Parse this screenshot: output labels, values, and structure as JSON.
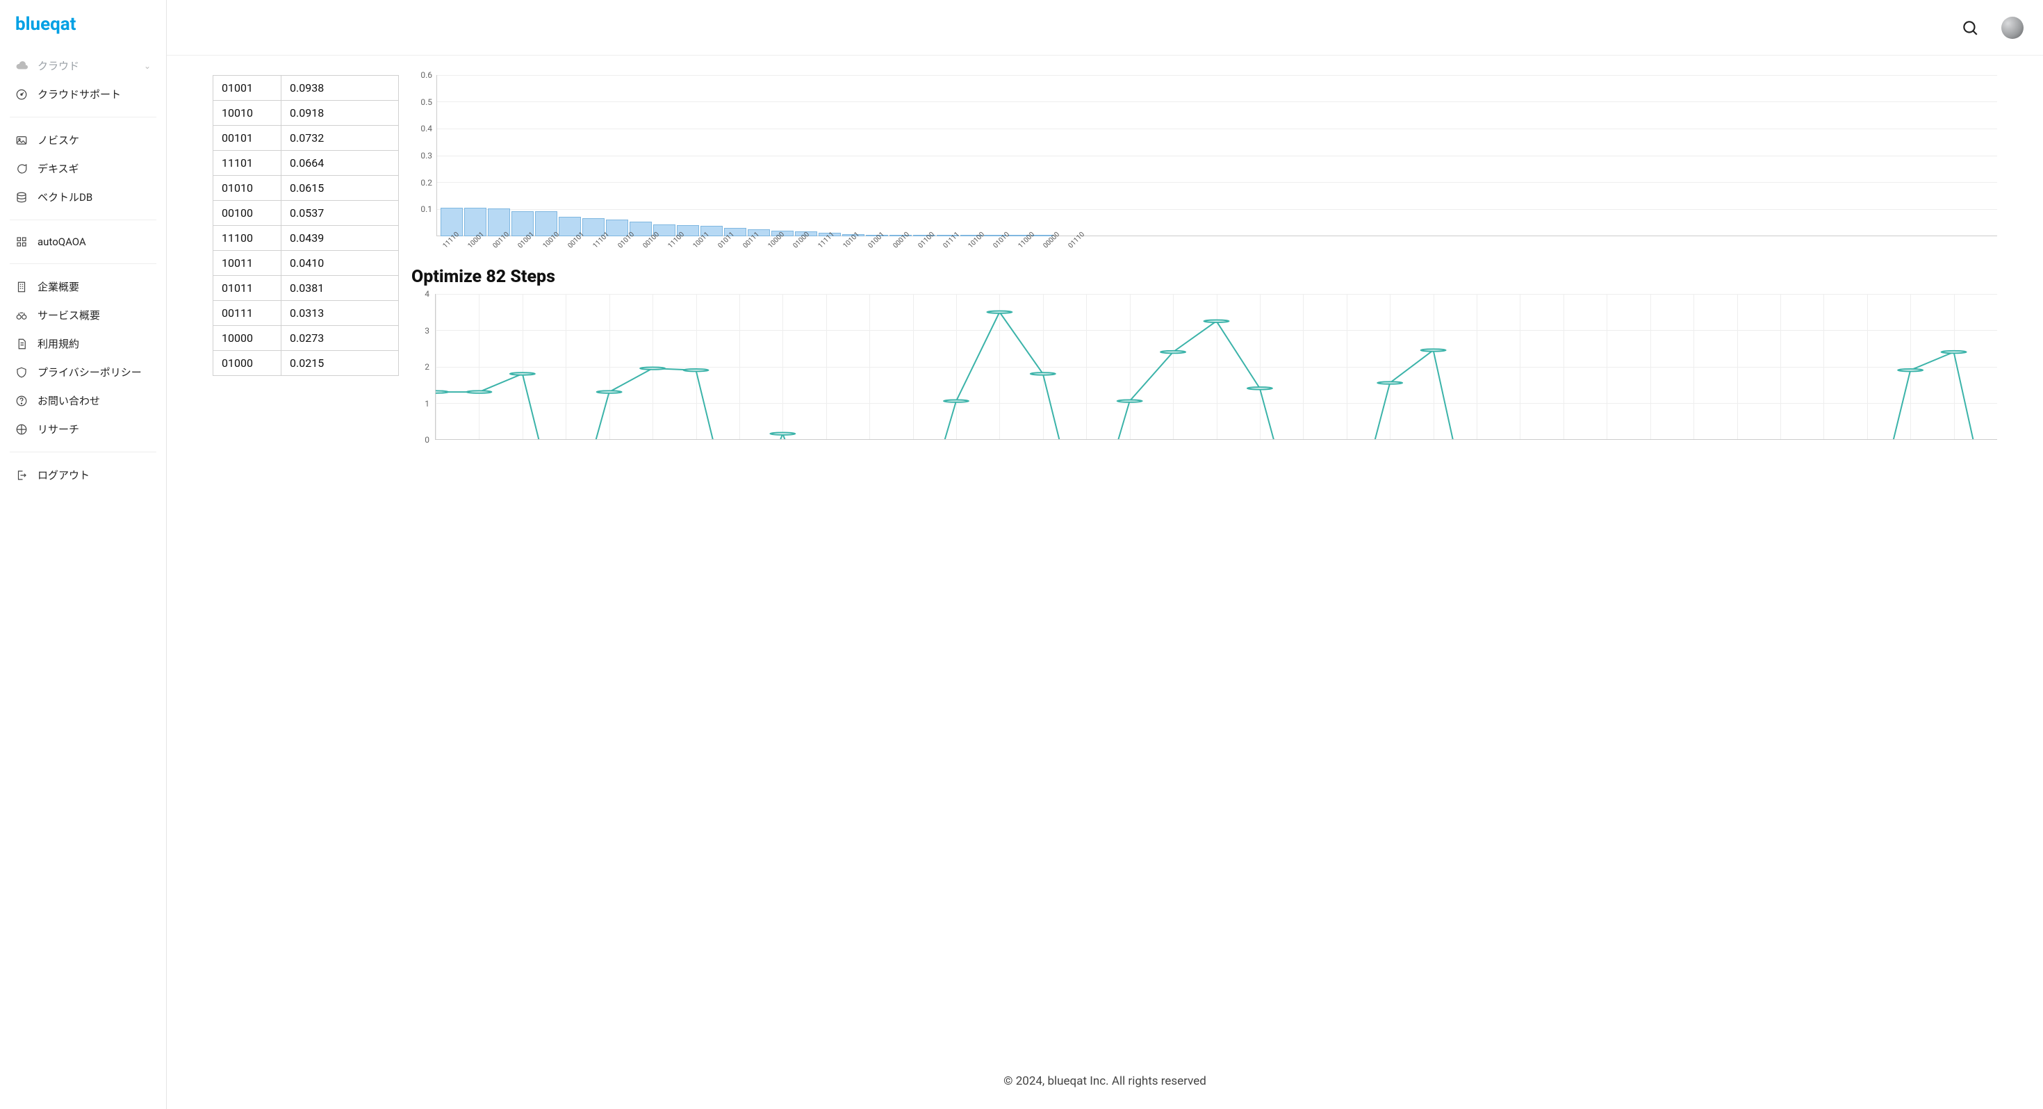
{
  "brand": "blueqat",
  "sidebar": {
    "cloud_label": "クラウド",
    "items": [
      {
        "icon": "gauge",
        "label": "クラウドサポート"
      },
      {
        "icon": "image",
        "label": "ノビスケ"
      },
      {
        "icon": "chat",
        "label": "デキスギ"
      },
      {
        "icon": "db",
        "label": "ベクトルDB"
      },
      {
        "icon": "grid",
        "label": "autoQAOA"
      },
      {
        "icon": "building",
        "label": "企業概要"
      },
      {
        "icon": "binoculars",
        "label": "サービス概要"
      },
      {
        "icon": "doc",
        "label": "利用規約"
      },
      {
        "icon": "shield",
        "label": "プライバシーポリシー"
      },
      {
        "icon": "help",
        "label": "お問い合わせ"
      },
      {
        "icon": "research",
        "label": "リサーチ"
      },
      {
        "icon": "logout",
        "label": "ログアウト"
      }
    ]
  },
  "table": {
    "rows": [
      {
        "state": "01001",
        "value": "0.0938"
      },
      {
        "state": "10010",
        "value": "0.0918"
      },
      {
        "state": "00101",
        "value": "0.0732"
      },
      {
        "state": "11101",
        "value": "0.0664"
      },
      {
        "state": "01010",
        "value": "0.0615"
      },
      {
        "state": "00100",
        "value": "0.0537"
      },
      {
        "state": "11100",
        "value": "0.0439"
      },
      {
        "state": "10011",
        "value": "0.0410"
      },
      {
        "state": "01011",
        "value": "0.0381"
      },
      {
        "state": "00111",
        "value": "0.0313"
      },
      {
        "state": "10000",
        "value": "0.0273"
      },
      {
        "state": "01000",
        "value": "0.0215"
      }
    ]
  },
  "chart_data": [
    {
      "type": "bar",
      "title": "",
      "xlabel": "",
      "ylabel": "",
      "ylim": [
        0,
        0.6
      ],
      "yticks": [
        0.1,
        0.2,
        0.3,
        0.4,
        0.5,
        0.6
      ],
      "categories": [
        "11110",
        "10001",
        "00110",
        "01001",
        "10010",
        "00101",
        "11101",
        "01010",
        "00100",
        "11100",
        "10011",
        "01011",
        "00111",
        "10000",
        "01000",
        "11111",
        "10101",
        "01001",
        "00010",
        "01100",
        "01111",
        "10100",
        "01010",
        "11000",
        "00000",
        "01110"
      ],
      "values": [
        0.105,
        0.105,
        0.103,
        0.094,
        0.092,
        0.073,
        0.066,
        0.062,
        0.054,
        0.044,
        0.041,
        0.038,
        0.031,
        0.027,
        0.022,
        0.017,
        0.013,
        0.008,
        0.003,
        0.001,
        0.001,
        0.001,
        0.001,
        0.001,
        0.001,
        0.001
      ]
    },
    {
      "type": "line",
      "title": "Optimize 82 Steps",
      "xlabel": "",
      "ylabel": "",
      "ylim": [
        0,
        4
      ],
      "yticks": [
        0,
        1,
        2,
        3,
        4
      ],
      "x": [
        0,
        1,
        2,
        3,
        4,
        5,
        6,
        7,
        8,
        9,
        10,
        11,
        12,
        13,
        14,
        15,
        16,
        17,
        18,
        19,
        20,
        21,
        22,
        23,
        24,
        25,
        26,
        27,
        28,
        29,
        30,
        31,
        32,
        33,
        34,
        35,
        36
      ],
      "values": [
        1.3,
        1.3,
        1.8,
        -3,
        1.3,
        1.95,
        1.9,
        -3,
        0.15,
        -3,
        -3,
        -3,
        1.05,
        3.5,
        1.8,
        -3,
        1.05,
        2.4,
        3.25,
        1.4,
        -3,
        -3,
        1.55,
        2.45,
        -3,
        -3,
        -3,
        -3,
        -3,
        -3,
        -3,
        -3,
        -3,
        -3,
        1.9,
        2.4,
        -3
      ]
    }
  ],
  "optimize_title": "Optimize 82 Steps",
  "footer": "© 2024, blueqat Inc. All rights reserved"
}
